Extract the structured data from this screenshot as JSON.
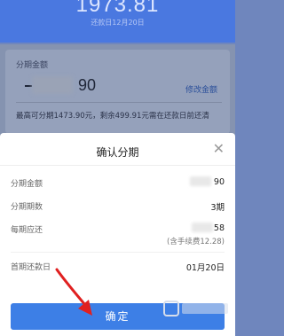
{
  "header": {
    "amount": "1973.81",
    "due_text": "还款日12月20日"
  },
  "card": {
    "label": "分期金额",
    "amount_suffix": "90",
    "modify_label": "修改金额",
    "note": "最高可分期1473.90元，剩余499.91元需在还款日前还清"
  },
  "sheet": {
    "title": "确认分期",
    "close_icon": "close-icon",
    "rows": [
      {
        "label": "分期金额",
        "value": "90"
      },
      {
        "label": "分期期数",
        "value": "3期"
      },
      {
        "label": "每期应还",
        "value": "58",
        "sub": "(含手续费12.28)"
      },
      {
        "label": "首期还款日",
        "value": "01月20日"
      }
    ],
    "confirm_label": "确定"
  },
  "colors": {
    "accent": "#3d7fe6",
    "arrow": "#e02020"
  }
}
